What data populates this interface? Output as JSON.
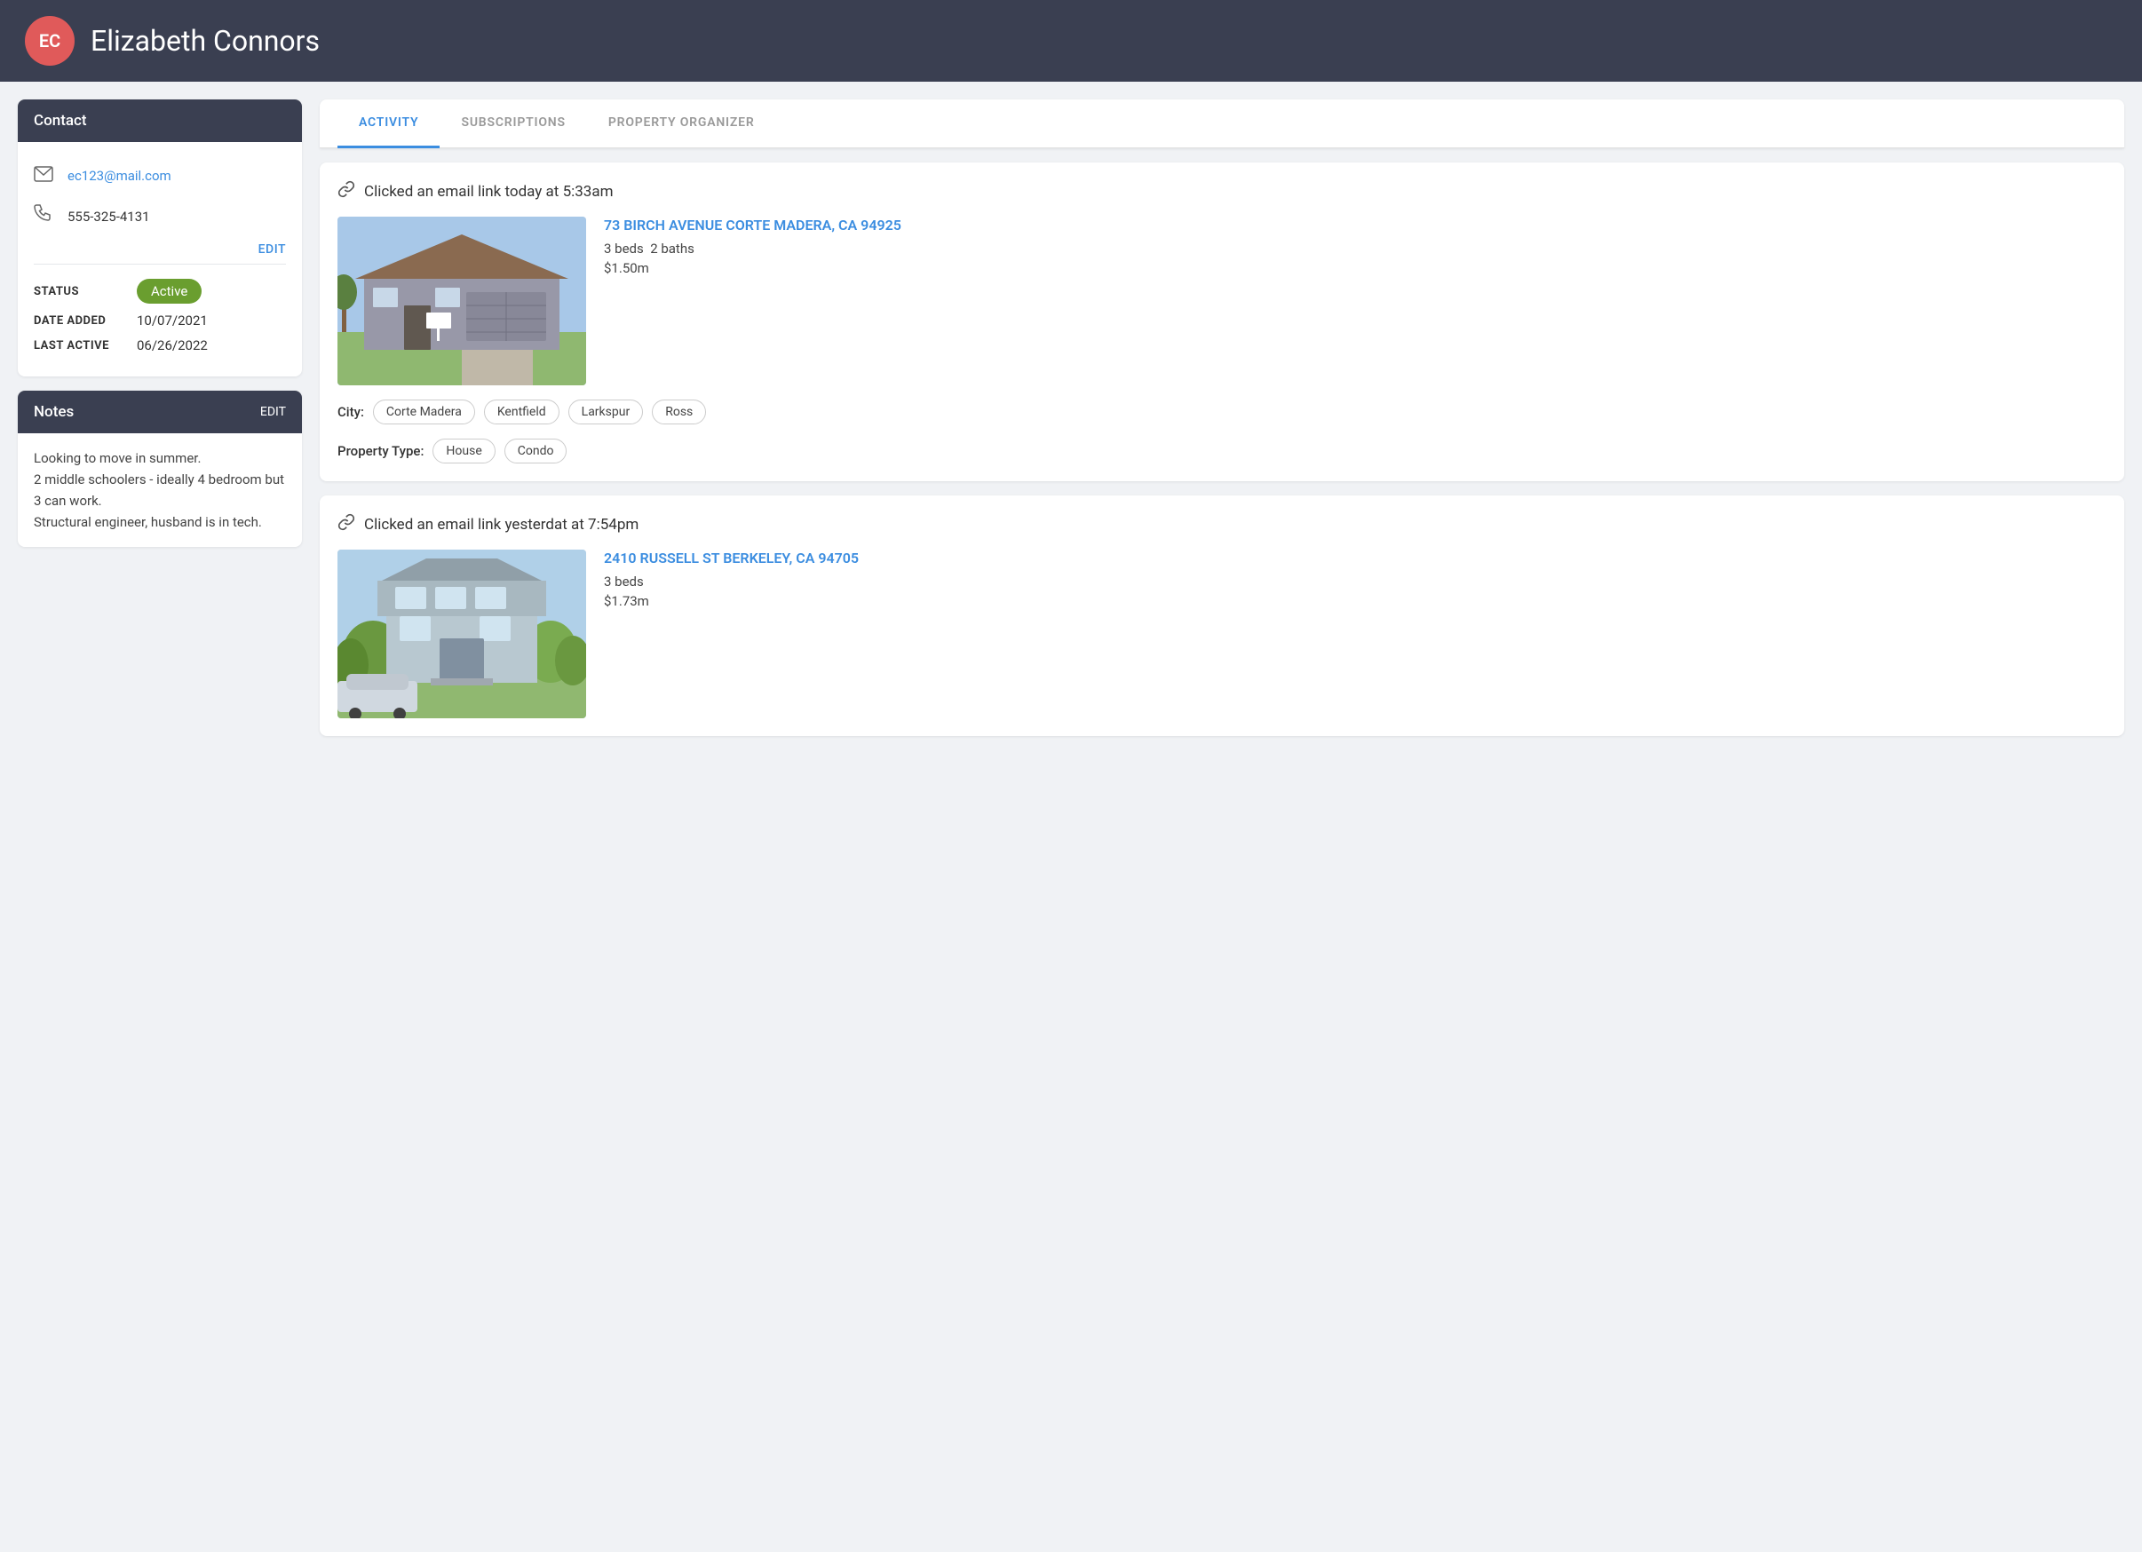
{
  "header": {
    "initials": "EC",
    "name": "Elizabeth Connors",
    "avatar_color": "#e05a5a"
  },
  "sidebar": {
    "contact": {
      "title": "Contact",
      "email": "ec123@mail.com",
      "phone": "555-325-4131",
      "edit_label": "EDIT"
    },
    "status": {
      "label": "STATUS",
      "value": "Active",
      "date_added_label": "DATE ADDED",
      "date_added": "10/07/2021",
      "last_active_label": "LAST ACTIVE",
      "last_active": "06/26/2022"
    },
    "notes": {
      "title": "Notes",
      "edit_label": "EDIT",
      "text_line1": "Looking to move in summer.",
      "text_line2": "2 middle schoolers - ideally 4 bedroom but 3 can work.",
      "text_line3": "Structural engineer, husband is in tech."
    }
  },
  "tabs": {
    "activity": "ACTIVITY",
    "subscriptions": "SUBSCRIPTIONS",
    "property_organizer": "PROPERTY ORGANIZER"
  },
  "activity": [
    {
      "event": "Clicked an email link today at 5:33am",
      "address": "73 BIRCH AVENUE CORTE MADERA, CA 94925",
      "beds": "3 beds",
      "baths": "2 baths",
      "price": "$1.50m",
      "city_label": "City:",
      "cities": [
        "Corte Madera",
        "Kentfield",
        "Larkspur",
        "Ross"
      ],
      "property_type_label": "Property Type:",
      "property_types": [
        "House",
        "Condo"
      ]
    },
    {
      "event": "Clicked an email link yesterdat at 7:54pm",
      "address": "2410 RUSSELL ST BERKELEY, CA 94705",
      "beds": "3 beds",
      "baths": "",
      "price": "$1.73m",
      "city_label": "",
      "cities": [],
      "property_type_label": "",
      "property_types": []
    }
  ]
}
